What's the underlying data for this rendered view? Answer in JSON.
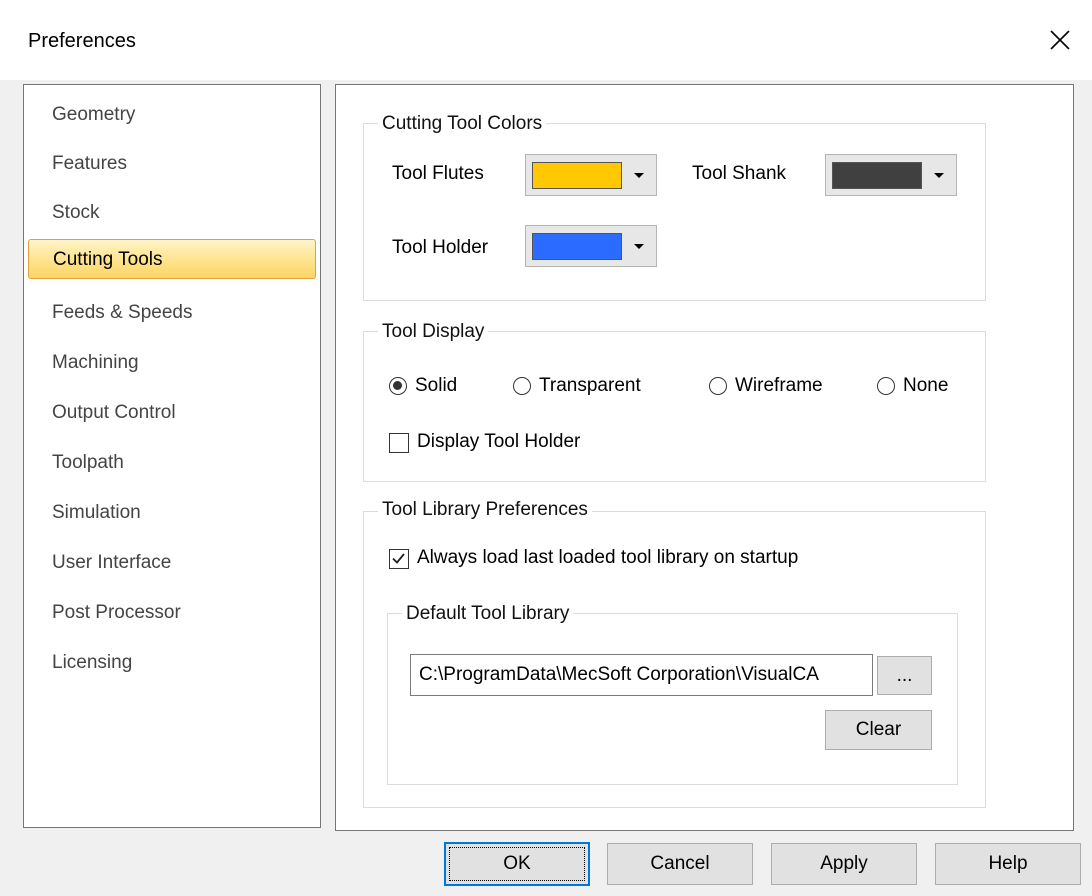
{
  "window": {
    "title": "Preferences"
  },
  "icons": {
    "close": "close-icon",
    "dropdown": "chevron-down-icon"
  },
  "nav": {
    "items": [
      {
        "label": "Geometry",
        "selected": false
      },
      {
        "label": "Features",
        "selected": false
      },
      {
        "label": "Stock",
        "selected": false
      },
      {
        "label": "Cutting Tools",
        "selected": true
      },
      {
        "label": "Feeds & Speeds",
        "selected": false
      },
      {
        "label": "Machining",
        "selected": false
      },
      {
        "label": "Output Control",
        "selected": false
      },
      {
        "label": "Toolpath",
        "selected": false
      },
      {
        "label": "Simulation",
        "selected": false
      },
      {
        "label": "User Interface",
        "selected": false
      },
      {
        "label": "Post Processor",
        "selected": false
      },
      {
        "label": "Licensing",
        "selected": false
      }
    ]
  },
  "colors_group": {
    "legend": "Cutting Tool Colors",
    "flutes": {
      "label": "Tool Flutes",
      "color": "#ffc800"
    },
    "shank": {
      "label": "Tool Shank",
      "color": "#404040"
    },
    "holder": {
      "label": "Tool Holder",
      "color": "#2b6bff"
    }
  },
  "display_group": {
    "legend": "Tool Display",
    "options": [
      {
        "label": "Solid",
        "checked": true
      },
      {
        "label": "Transparent",
        "checked": false
      },
      {
        "label": "Wireframe",
        "checked": false
      },
      {
        "label": "None",
        "checked": false
      }
    ],
    "show_holder": {
      "label": "Display Tool Holder",
      "checked": false
    }
  },
  "library_group": {
    "legend": "Tool Library Preferences",
    "always_load": {
      "label": "Always load last loaded tool library on startup",
      "checked": true
    },
    "default_lib": {
      "legend": "Default Tool Library",
      "path": "C:\\ProgramData\\MecSoft Corporation\\VisualCA",
      "browse_label": "...",
      "clear_label": "Clear"
    }
  },
  "buttons": {
    "ok": "OK",
    "cancel": "Cancel",
    "apply": "Apply",
    "help": "Help"
  }
}
